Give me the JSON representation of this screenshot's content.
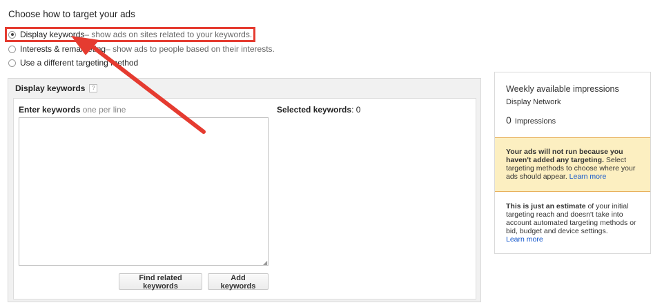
{
  "heading": "Choose how to target your ads",
  "targeting_options": [
    {
      "label": "Display keywords",
      "description": " – show ads on sites related to your keywords.",
      "checked": true
    },
    {
      "label": "Interests & remarketing",
      "description": " – show ads to people based on their interests.",
      "checked": false
    },
    {
      "label": "Use a different targeting method",
      "description": "",
      "checked": false
    }
  ],
  "panel": {
    "title": "Display keywords",
    "help_icon_glyph": "?",
    "enter_label": "Enter keywords",
    "enter_hint": " one per line",
    "textarea_value": "",
    "selected_label": "Selected keywords",
    "selected_count": ": 0",
    "find_button": "Find related keywords",
    "add_button": "Add keywords"
  },
  "sidebar": {
    "title": "Weekly available impressions",
    "network": "Display Network",
    "impressions_count": "0",
    "impressions_label": "Impressions",
    "warning_bold": "Your ads will not run because you haven't added any targeting.",
    "warning_text": " Select targeting methods to choose where your ads should appear. ",
    "warning_link": "Learn more",
    "note_bold": "This is just an estimate",
    "note_text": " of your initial targeting reach and doesn't take into account automated targeting methods or bid, budget and device settings.",
    "note_link": "Learn more"
  },
  "colors": {
    "highlight": "#e53b30",
    "warning_bg": "#fcefc1",
    "link": "#1155cc"
  }
}
